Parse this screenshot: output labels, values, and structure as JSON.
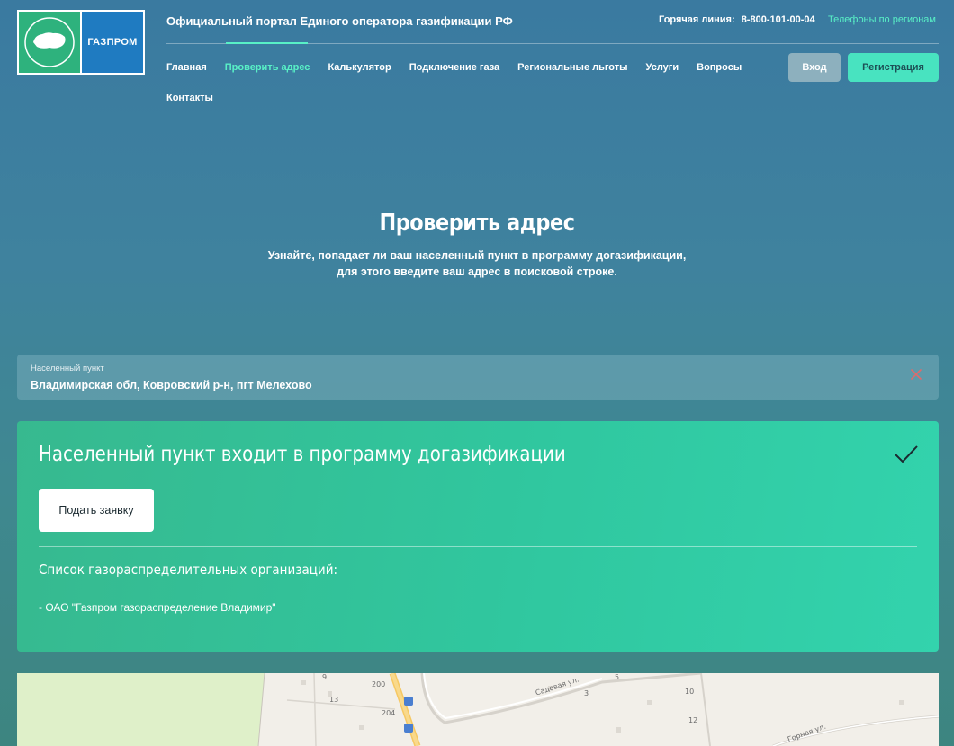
{
  "header": {
    "logo_left_icon": "gazifikatsiya-russia-map-logo",
    "logo_right_text": "ГАЗПРОМ",
    "portal_title": "Официальный портал Единого оператора газификации РФ",
    "hotline_label": "Горячая линия:",
    "hotline_number": "8-800-101-00-04",
    "regions_link": "Телефоны по регионам",
    "login_label": "Вход",
    "register_label": "Регистрация",
    "accent_color": "#58f0c6"
  },
  "nav": {
    "items": [
      {
        "label": "Главная",
        "active": false
      },
      {
        "label": "Проверить адрес",
        "active": true
      },
      {
        "label": "Калькулятор",
        "active": false
      },
      {
        "label": "Подключение газа",
        "active": false
      },
      {
        "label": "Региональные льготы",
        "active": false
      },
      {
        "label": "Услуги",
        "active": false
      },
      {
        "label": "Вопросы",
        "active": false
      },
      {
        "label": "Контакты",
        "active": false
      }
    ]
  },
  "hero": {
    "title": "Проверить адрес",
    "subtitle_line1": "Узнайте, попадает ли ваш населенный пункт в программу догазификации,",
    "subtitle_line2": "для этого введите ваш адрес в поисковой строке."
  },
  "search": {
    "label": "Населенный пункт",
    "value": "Владимирская обл, Ковровский р-н, пгт Мелехово",
    "clear_icon": "close-icon"
  },
  "result": {
    "title": "Населенный пункт входит в программу догазификации",
    "status_icon": "check-icon",
    "apply_label": "Подать заявку",
    "orgs_title": "Список газораспределительных организаций:",
    "orgs": [
      "- ОАО \"Газпром газораспределение Владимир\""
    ]
  },
  "map": {
    "labels": {
      "n9": "9",
      "n200": "200",
      "n13": "13",
      "n204": "204",
      "street_sadovaya": "Садовая ул.",
      "n5": "5",
      "n3": "3",
      "n10": "10",
      "n12": "12",
      "street_gornaya": "Горная ул."
    }
  }
}
